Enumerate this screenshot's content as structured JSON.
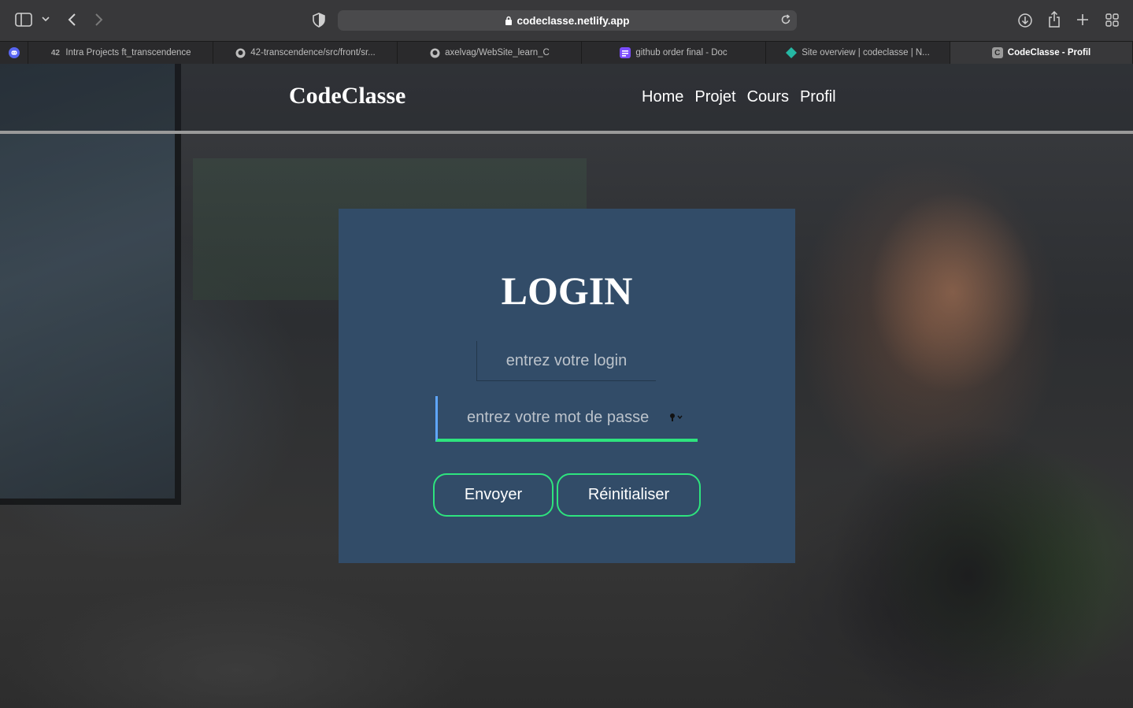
{
  "browser": {
    "url": "codeclasse.netlify.app",
    "tabs": [
      {
        "label": "",
        "icon": "discord-icon"
      },
      {
        "label": "Intra Projects ft_transcendence",
        "icon": "42-logo-icon"
      },
      {
        "label": "42-transcendence/src/front/sr...",
        "icon": "github-icon"
      },
      {
        "label": "axelvag/WebSite_learn_C",
        "icon": "github-icon"
      },
      {
        "label": "github order final - Doc",
        "icon": "doc-icon"
      },
      {
        "label": "Site overview | codeclasse | N...",
        "icon": "netlify-icon"
      },
      {
        "label": "CodeClasse - Profil",
        "icon": "codeclasse-favicon",
        "active": true
      }
    ]
  },
  "site": {
    "logo": "CodeClasse",
    "nav": [
      "Home",
      "Projet",
      "Cours",
      "Profil"
    ]
  },
  "login": {
    "title": "LOGIN",
    "login_placeholder": "entrez votre login",
    "password_placeholder": "entrez votre mot de passe",
    "submit_label": "Envoyer",
    "reset_label": "Réinitialiser"
  },
  "colors": {
    "panel": "#324c68",
    "button_border": "#2ee37e",
    "focus_left_border": "#5fa6ff"
  }
}
